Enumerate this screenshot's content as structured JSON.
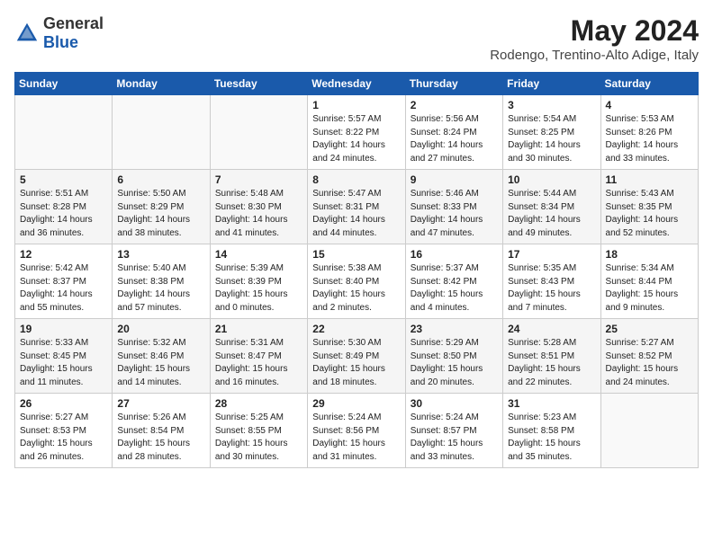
{
  "logo": {
    "general": "General",
    "blue": "Blue"
  },
  "title": {
    "month": "May 2024",
    "location": "Rodengo, Trentino-Alto Adige, Italy"
  },
  "days_of_week": [
    "Sunday",
    "Monday",
    "Tuesday",
    "Wednesday",
    "Thursday",
    "Friday",
    "Saturday"
  ],
  "weeks": [
    [
      {
        "day": "",
        "sunrise": "",
        "sunset": "",
        "daylight": ""
      },
      {
        "day": "",
        "sunrise": "",
        "sunset": "",
        "daylight": ""
      },
      {
        "day": "",
        "sunrise": "",
        "sunset": "",
        "daylight": ""
      },
      {
        "day": "1",
        "sunrise": "Sunrise: 5:57 AM",
        "sunset": "Sunset: 8:22 PM",
        "daylight": "Daylight: 14 hours and 24 minutes."
      },
      {
        "day": "2",
        "sunrise": "Sunrise: 5:56 AM",
        "sunset": "Sunset: 8:24 PM",
        "daylight": "Daylight: 14 hours and 27 minutes."
      },
      {
        "day": "3",
        "sunrise": "Sunrise: 5:54 AM",
        "sunset": "Sunset: 8:25 PM",
        "daylight": "Daylight: 14 hours and 30 minutes."
      },
      {
        "day": "4",
        "sunrise": "Sunrise: 5:53 AM",
        "sunset": "Sunset: 8:26 PM",
        "daylight": "Daylight: 14 hours and 33 minutes."
      }
    ],
    [
      {
        "day": "5",
        "sunrise": "Sunrise: 5:51 AM",
        "sunset": "Sunset: 8:28 PM",
        "daylight": "Daylight: 14 hours and 36 minutes."
      },
      {
        "day": "6",
        "sunrise": "Sunrise: 5:50 AM",
        "sunset": "Sunset: 8:29 PM",
        "daylight": "Daylight: 14 hours and 38 minutes."
      },
      {
        "day": "7",
        "sunrise": "Sunrise: 5:48 AM",
        "sunset": "Sunset: 8:30 PM",
        "daylight": "Daylight: 14 hours and 41 minutes."
      },
      {
        "day": "8",
        "sunrise": "Sunrise: 5:47 AM",
        "sunset": "Sunset: 8:31 PM",
        "daylight": "Daylight: 14 hours and 44 minutes."
      },
      {
        "day": "9",
        "sunrise": "Sunrise: 5:46 AM",
        "sunset": "Sunset: 8:33 PM",
        "daylight": "Daylight: 14 hours and 47 minutes."
      },
      {
        "day": "10",
        "sunrise": "Sunrise: 5:44 AM",
        "sunset": "Sunset: 8:34 PM",
        "daylight": "Daylight: 14 hours and 49 minutes."
      },
      {
        "day": "11",
        "sunrise": "Sunrise: 5:43 AM",
        "sunset": "Sunset: 8:35 PM",
        "daylight": "Daylight: 14 hours and 52 minutes."
      }
    ],
    [
      {
        "day": "12",
        "sunrise": "Sunrise: 5:42 AM",
        "sunset": "Sunset: 8:37 PM",
        "daylight": "Daylight: 14 hours and 55 minutes."
      },
      {
        "day": "13",
        "sunrise": "Sunrise: 5:40 AM",
        "sunset": "Sunset: 8:38 PM",
        "daylight": "Daylight: 14 hours and 57 minutes."
      },
      {
        "day": "14",
        "sunrise": "Sunrise: 5:39 AM",
        "sunset": "Sunset: 8:39 PM",
        "daylight": "Daylight: 15 hours and 0 minutes."
      },
      {
        "day": "15",
        "sunrise": "Sunrise: 5:38 AM",
        "sunset": "Sunset: 8:40 PM",
        "daylight": "Daylight: 15 hours and 2 minutes."
      },
      {
        "day": "16",
        "sunrise": "Sunrise: 5:37 AM",
        "sunset": "Sunset: 8:42 PM",
        "daylight": "Daylight: 15 hours and 4 minutes."
      },
      {
        "day": "17",
        "sunrise": "Sunrise: 5:35 AM",
        "sunset": "Sunset: 8:43 PM",
        "daylight": "Daylight: 15 hours and 7 minutes."
      },
      {
        "day": "18",
        "sunrise": "Sunrise: 5:34 AM",
        "sunset": "Sunset: 8:44 PM",
        "daylight": "Daylight: 15 hours and 9 minutes."
      }
    ],
    [
      {
        "day": "19",
        "sunrise": "Sunrise: 5:33 AM",
        "sunset": "Sunset: 8:45 PM",
        "daylight": "Daylight: 15 hours and 11 minutes."
      },
      {
        "day": "20",
        "sunrise": "Sunrise: 5:32 AM",
        "sunset": "Sunset: 8:46 PM",
        "daylight": "Daylight: 15 hours and 14 minutes."
      },
      {
        "day": "21",
        "sunrise": "Sunrise: 5:31 AM",
        "sunset": "Sunset: 8:47 PM",
        "daylight": "Daylight: 15 hours and 16 minutes."
      },
      {
        "day": "22",
        "sunrise": "Sunrise: 5:30 AM",
        "sunset": "Sunset: 8:49 PM",
        "daylight": "Daylight: 15 hours and 18 minutes."
      },
      {
        "day": "23",
        "sunrise": "Sunrise: 5:29 AM",
        "sunset": "Sunset: 8:50 PM",
        "daylight": "Daylight: 15 hours and 20 minutes."
      },
      {
        "day": "24",
        "sunrise": "Sunrise: 5:28 AM",
        "sunset": "Sunset: 8:51 PM",
        "daylight": "Daylight: 15 hours and 22 minutes."
      },
      {
        "day": "25",
        "sunrise": "Sunrise: 5:27 AM",
        "sunset": "Sunset: 8:52 PM",
        "daylight": "Daylight: 15 hours and 24 minutes."
      }
    ],
    [
      {
        "day": "26",
        "sunrise": "Sunrise: 5:27 AM",
        "sunset": "Sunset: 8:53 PM",
        "daylight": "Daylight: 15 hours and 26 minutes."
      },
      {
        "day": "27",
        "sunrise": "Sunrise: 5:26 AM",
        "sunset": "Sunset: 8:54 PM",
        "daylight": "Daylight: 15 hours and 28 minutes."
      },
      {
        "day": "28",
        "sunrise": "Sunrise: 5:25 AM",
        "sunset": "Sunset: 8:55 PM",
        "daylight": "Daylight: 15 hours and 30 minutes."
      },
      {
        "day": "29",
        "sunrise": "Sunrise: 5:24 AM",
        "sunset": "Sunset: 8:56 PM",
        "daylight": "Daylight: 15 hours and 31 minutes."
      },
      {
        "day": "30",
        "sunrise": "Sunrise: 5:24 AM",
        "sunset": "Sunset: 8:57 PM",
        "daylight": "Daylight: 15 hours and 33 minutes."
      },
      {
        "day": "31",
        "sunrise": "Sunrise: 5:23 AM",
        "sunset": "Sunset: 8:58 PM",
        "daylight": "Daylight: 15 hours and 35 minutes."
      },
      {
        "day": "",
        "sunrise": "",
        "sunset": "",
        "daylight": ""
      }
    ]
  ]
}
